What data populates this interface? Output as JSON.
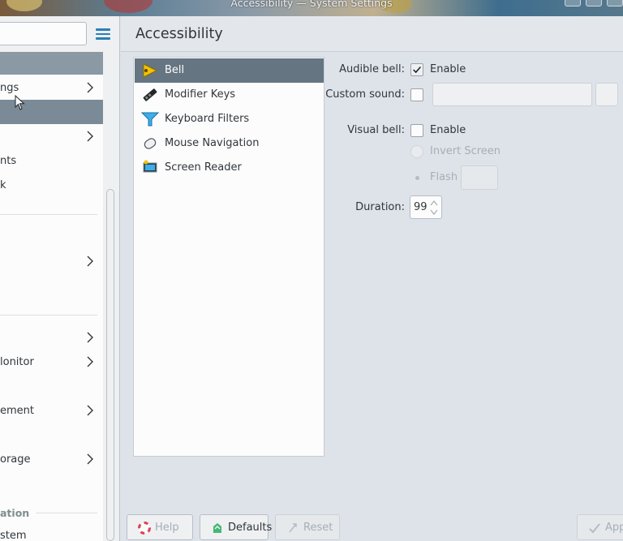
{
  "window": {
    "title": "Accessibility — System Settings"
  },
  "sidebar": {
    "items": [
      {
        "label": "ngs"
      },
      {
        "label": "nts"
      },
      {
        "label": "k"
      },
      {
        "label": "lonitor"
      },
      {
        "label": "ement"
      },
      {
        "label": "orage"
      },
      {
        "label": "stem"
      }
    ],
    "group_label": "ation"
  },
  "page": {
    "title": "Accessibility"
  },
  "modules": [
    {
      "label": "Bell",
      "icon": "bell-icon"
    },
    {
      "label": "Modifier Keys",
      "icon": "keyboard-key-icon"
    },
    {
      "label": "Keyboard Filters",
      "icon": "filter-icon"
    },
    {
      "label": "Mouse Navigation",
      "icon": "mouse-icon"
    },
    {
      "label": "Screen Reader",
      "icon": "screen-reader-icon"
    }
  ],
  "bell_form": {
    "audible_bell_label": "Audible bell:",
    "audible_bell_option": "Enable",
    "audible_bell_checked": true,
    "custom_sound_label": "Custom sound:",
    "custom_sound_value": "",
    "visual_bell_label": "Visual bell:",
    "visual_bell_option": "Enable",
    "visual_bell_checked": false,
    "invert_screen_label": "Invert Screen",
    "flash_label": "Flash",
    "duration_label": "Duration:",
    "duration_value": "99"
  },
  "buttons": {
    "help": "Help",
    "defaults": "Defaults",
    "reset": "Reset",
    "apply": "App"
  },
  "colors": {
    "accent": "#2980b9",
    "selection": "#657582",
    "background": "#dee3ea"
  }
}
